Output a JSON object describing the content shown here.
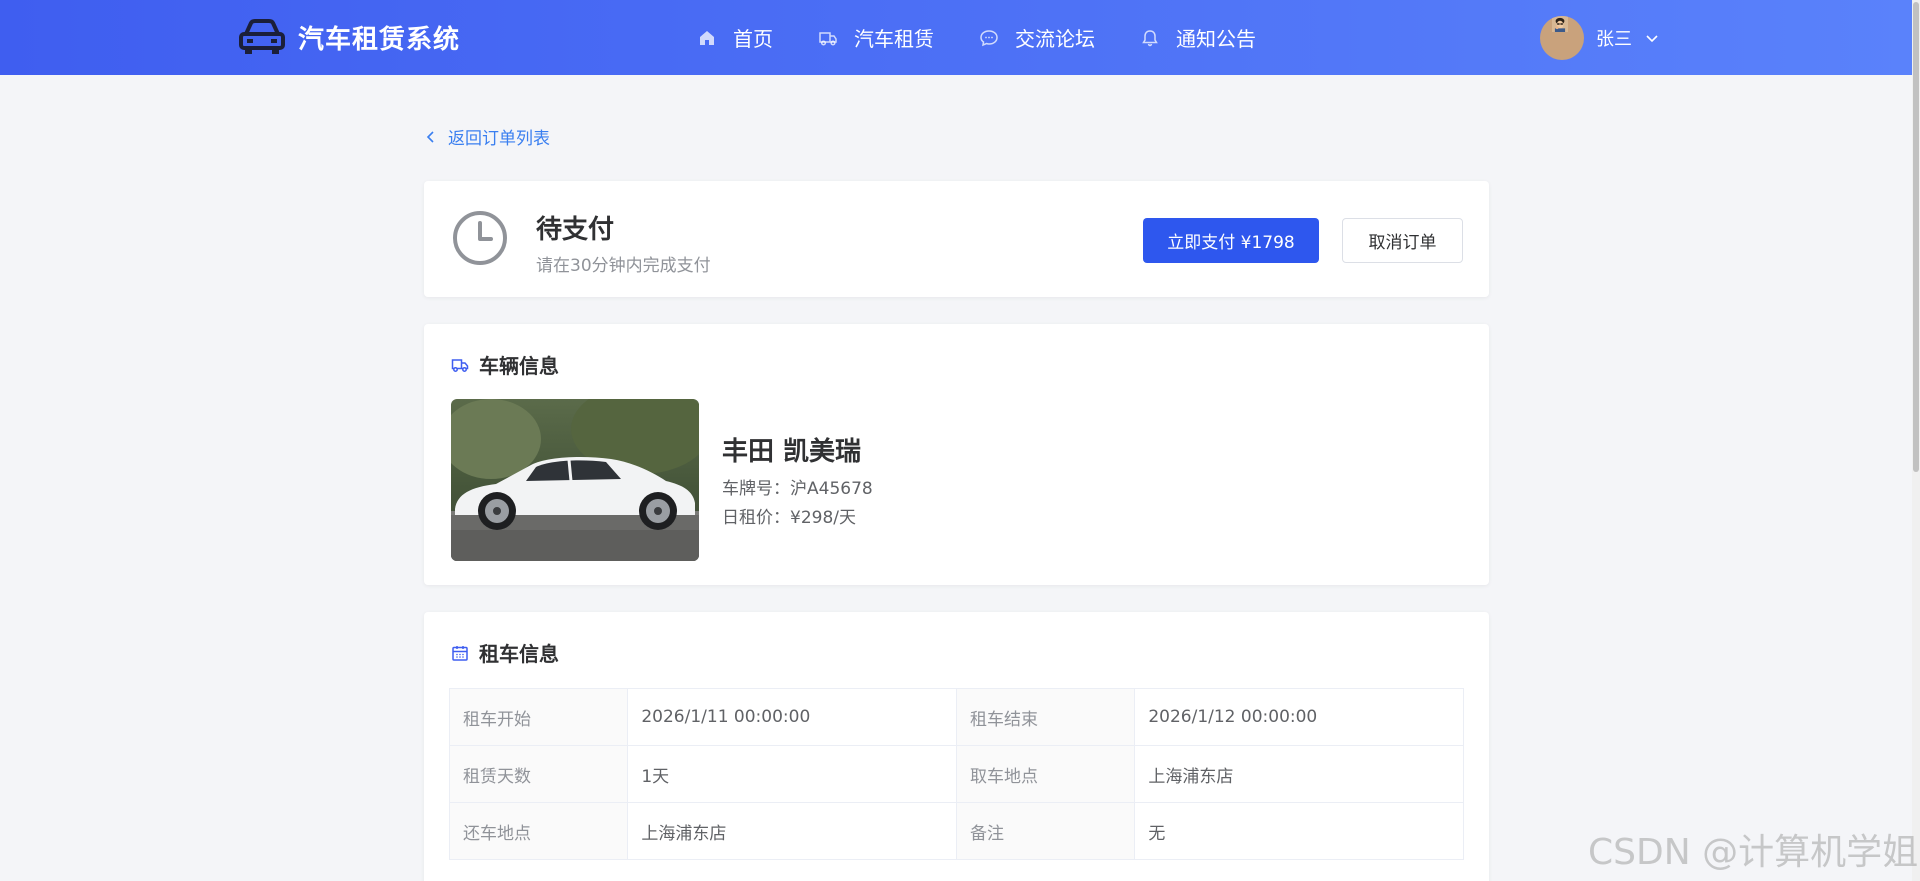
{
  "header": {
    "app_title": "汽车租赁系统",
    "nav": [
      {
        "label": "首页",
        "icon": "home-icon"
      },
      {
        "label": "汽车租赁",
        "icon": "truck-icon"
      },
      {
        "label": "交流论坛",
        "icon": "chat-icon"
      },
      {
        "label": "通知公告",
        "icon": "bell-icon"
      }
    ],
    "user_name": "张三"
  },
  "back_link": "返回订单列表",
  "status": {
    "title": "待支付",
    "subtitle": "请在30分钟内完成支付",
    "pay_button": "立即支付 ¥1798",
    "cancel_button": "取消订单"
  },
  "vehicle": {
    "section_title": "车辆信息",
    "name": "丰田 凯美瑞",
    "plate": "车牌号：沪A45678",
    "daily_price": "日租价：¥298/天"
  },
  "rental": {
    "section_title": "租车信息",
    "rows": [
      [
        {
          "k": "租车开始",
          "v": "2026/1/11 00:00:00"
        },
        {
          "k": "租车结束",
          "v": "2026/1/12 00:00:00"
        }
      ],
      [
        {
          "k": "租赁天数",
          "v": "1天"
        },
        {
          "k": "取车地点",
          "v": "上海浦东店"
        }
      ],
      [
        {
          "k": "还车地点",
          "v": "上海浦东店"
        },
        {
          "k": "备注",
          "v": "无"
        }
      ]
    ]
  },
  "watermark": "CSDN @计算机学姐",
  "colors": {
    "primary": "#2e57ee",
    "header_start": "#3f5ef0",
    "header_end": "#5a82fb",
    "link": "#3a7ff0"
  }
}
